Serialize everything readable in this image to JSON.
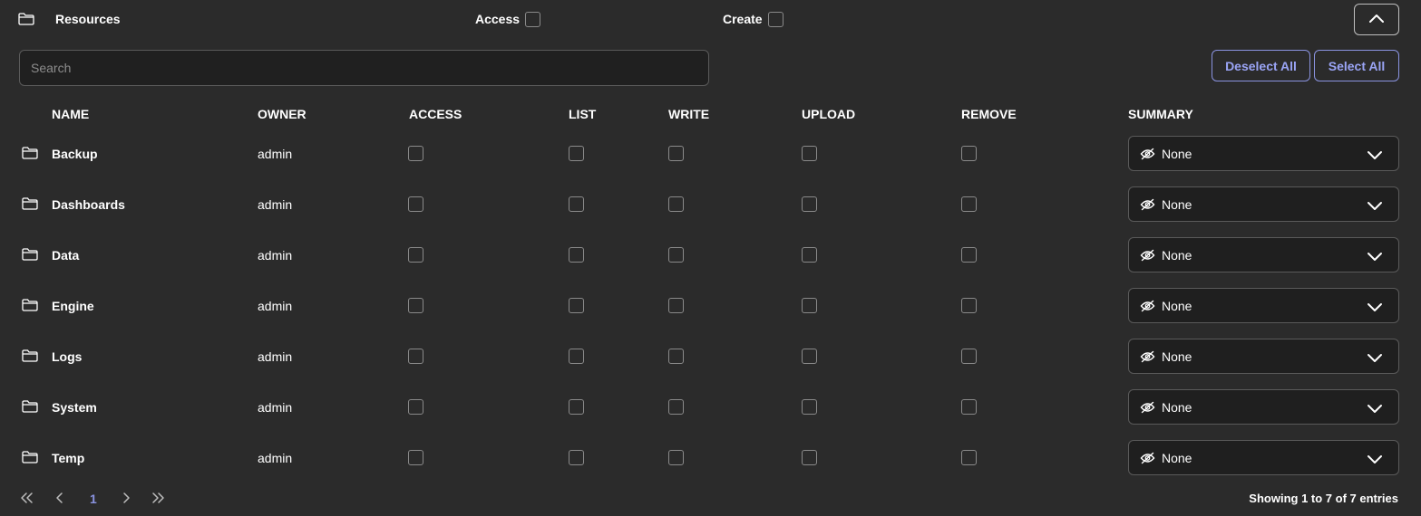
{
  "header": {
    "title": "Resources",
    "access_label": "Access",
    "create_label": "Create"
  },
  "search": {
    "placeholder": "Search",
    "value": ""
  },
  "actions": {
    "deselect_all": "Deselect All",
    "select_all": "Select All"
  },
  "columns": [
    "NAME",
    "OWNER",
    "ACCESS",
    "LIST",
    "WRITE",
    "UPLOAD",
    "REMOVE",
    "SUMMARY"
  ],
  "rows": [
    {
      "name": "Backup",
      "owner": "admin",
      "summary": "None"
    },
    {
      "name": "Dashboards",
      "owner": "admin",
      "summary": "None"
    },
    {
      "name": "Data",
      "owner": "admin",
      "summary": "None"
    },
    {
      "name": "Engine",
      "owner": "admin",
      "summary": "None"
    },
    {
      "name": "Logs",
      "owner": "admin",
      "summary": "None"
    },
    {
      "name": "System",
      "owner": "admin",
      "summary": "None"
    },
    {
      "name": "Temp",
      "owner": "admin",
      "summary": "None"
    }
  ],
  "pagination": {
    "current_page": "1",
    "entries_text": "Showing 1 to 7 of 7 entries"
  },
  "colors": {
    "background": "#2b2b2b",
    "accent": "#9aa4f5",
    "input_bg": "#1f1f1f"
  }
}
